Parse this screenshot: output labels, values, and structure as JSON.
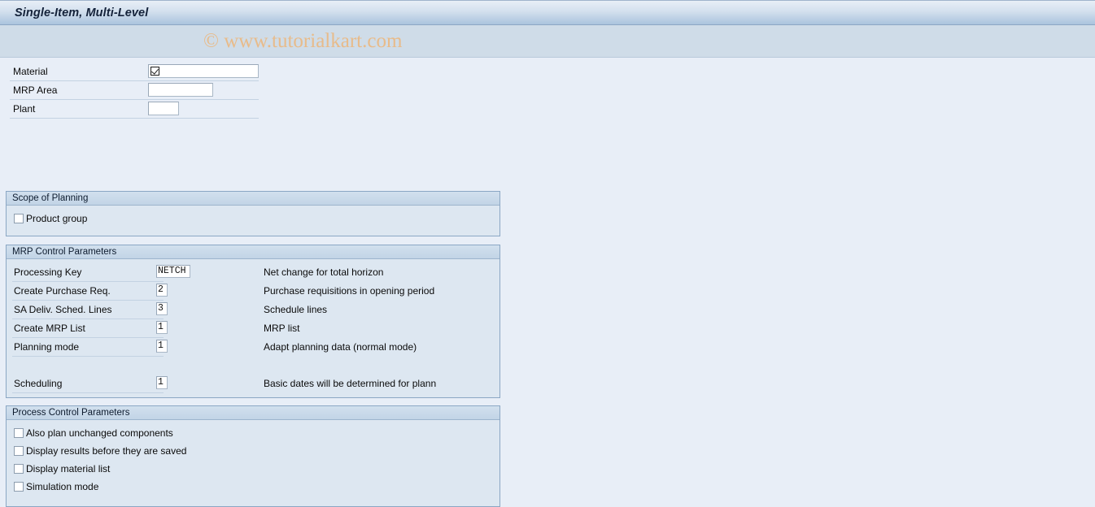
{
  "window": {
    "title": "Single-Item, Multi-Level"
  },
  "watermark": {
    "text": "© www.tutorialkart.com",
    "color": "#e8bb8a"
  },
  "header_fields": [
    {
      "label": "Material",
      "value": "",
      "has_checkbox_icon": true
    },
    {
      "label": "MRP Area",
      "value": "",
      "has_checkbox_icon": false
    },
    {
      "label": "Plant",
      "value": "",
      "has_checkbox_icon": false
    }
  ],
  "scope_of_planning": {
    "title": "Scope of Planning",
    "options": [
      {
        "label": "Product group",
        "checked": false
      }
    ]
  },
  "mrp_control_parameters": {
    "title": "MRP Control Parameters",
    "rows": [
      {
        "label": "Processing Key",
        "value": "NETCH",
        "description": "Net change for total horizon"
      },
      {
        "label": "Create Purchase Req.",
        "value": "2",
        "description": "Purchase requisitions in opening period"
      },
      {
        "label": "SA Deliv. Sched. Lines",
        "value": "3",
        "description": "Schedule lines"
      },
      {
        "label": "Create MRP List",
        "value": "1",
        "description": "MRP list"
      },
      {
        "label": "Planning mode",
        "value": "1",
        "description": "Adapt planning data (normal mode)"
      },
      {
        "label": "Scheduling",
        "value": "1",
        "description": "Basic dates will be determined for plann"
      }
    ]
  },
  "process_control_parameters": {
    "title": "Process Control Parameters",
    "options": [
      {
        "label": "Also plan unchanged components",
        "checked": false
      },
      {
        "label": "Display results before they are saved",
        "checked": false
      },
      {
        "label": "Display material list",
        "checked": false
      },
      {
        "label": "Simulation mode",
        "checked": false
      }
    ]
  }
}
